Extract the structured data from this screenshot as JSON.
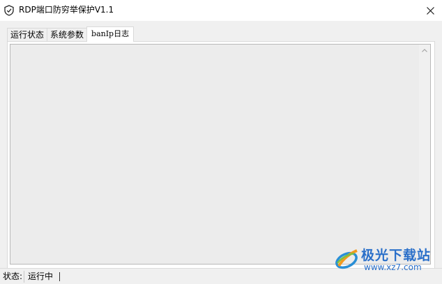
{
  "window": {
    "title": "RDP端口防穷举保护V1.1",
    "icon": "shield-check-icon"
  },
  "tabs": [
    {
      "label": "运行状态",
      "active": false
    },
    {
      "label": "系统参数",
      "active": false
    },
    {
      "label": "banIp日志",
      "active": true
    }
  ],
  "log": {
    "content": ""
  },
  "statusbar": {
    "label": "状态:",
    "value": "运行中"
  },
  "watermark": {
    "name": "极光下载站",
    "url": "www.xz7.com"
  }
}
